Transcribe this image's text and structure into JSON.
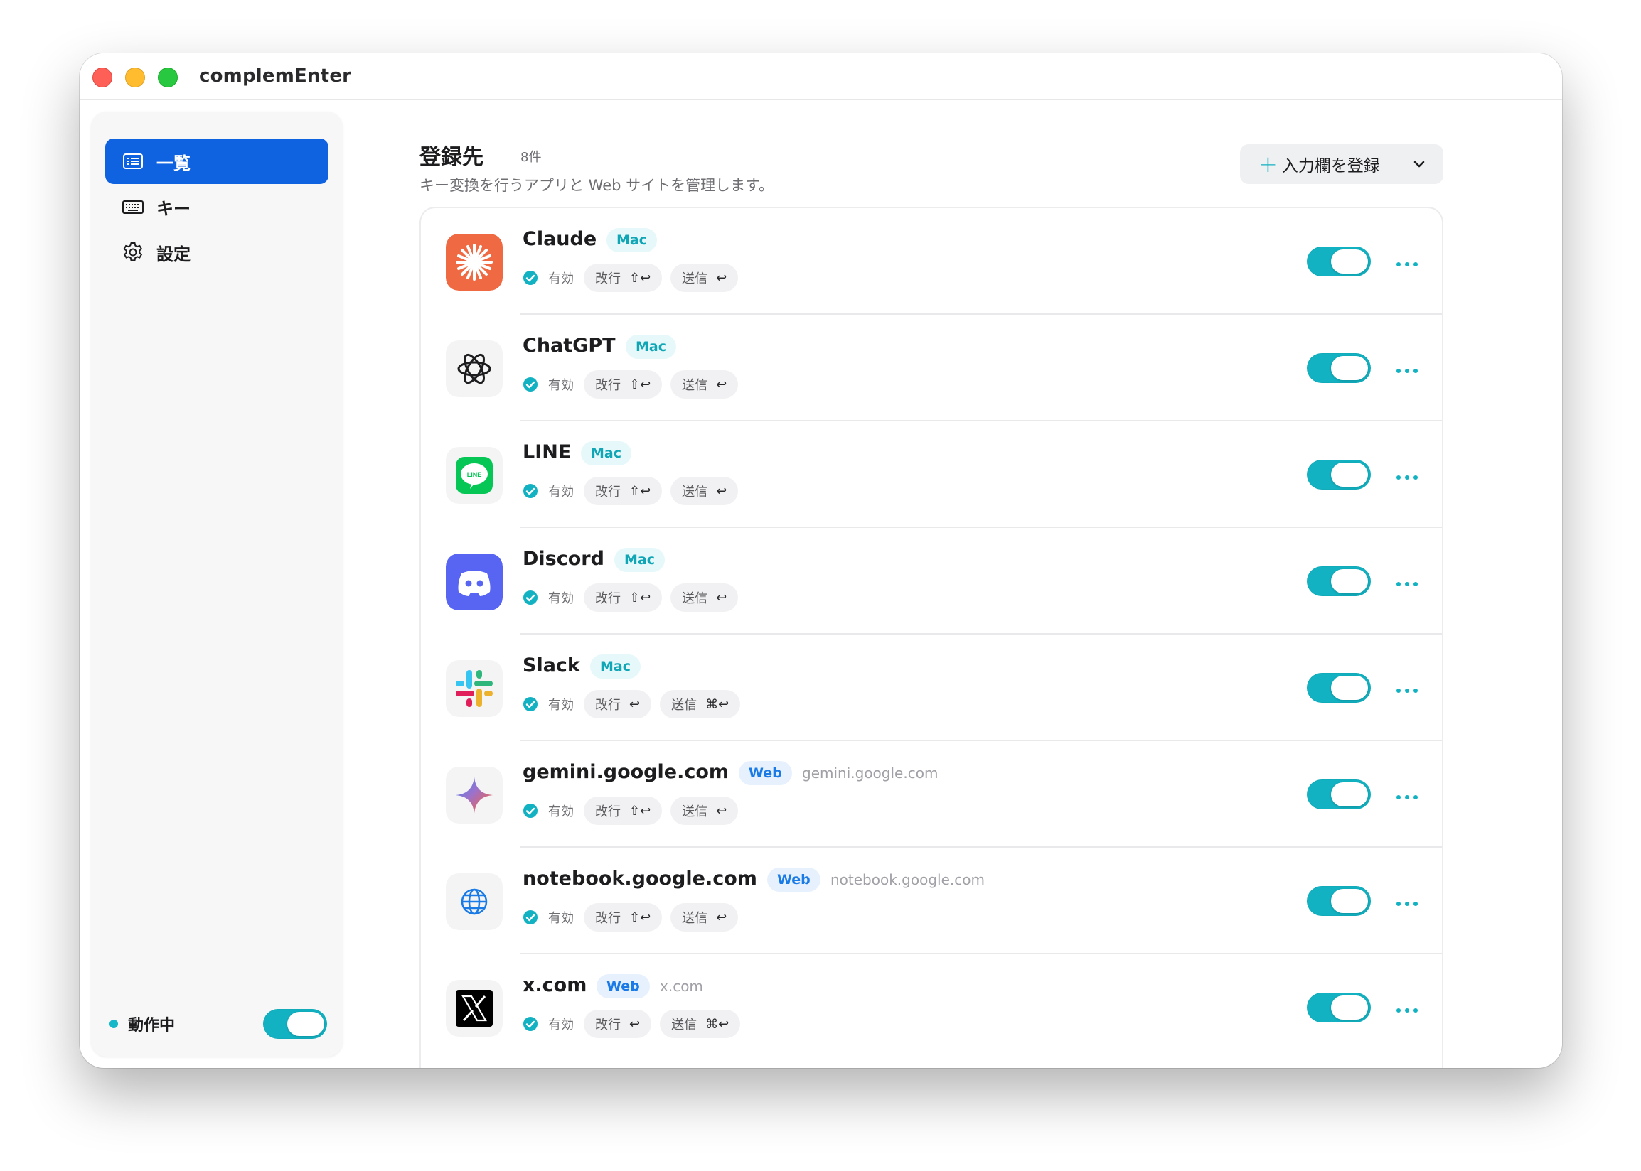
{
  "window": {
    "title": "complemEnter"
  },
  "sidebar": {
    "items": [
      {
        "label": "一覧",
        "icon": "list-icon",
        "active": true
      },
      {
        "label": "キー",
        "icon": "keyboard-icon",
        "active": false
      },
      {
        "label": "設定",
        "icon": "gear-icon",
        "active": false
      }
    ],
    "status_label": "動作中",
    "status_on": true
  },
  "header": {
    "title": "登録先",
    "count": "8件",
    "subtitle": "キー変換を行うアプリと Web サイトを管理します。",
    "register_label": "入力欄を登録"
  },
  "colors": {
    "accent": "#12b2c2",
    "active_nav": "#0f62e0",
    "mac_badge": "#11a6b6",
    "web_badge": "#1a7ae6"
  },
  "entries": [
    {
      "name": "Claude",
      "platform": "Mac",
      "domain": "",
      "icon": "claude-icon",
      "status": "有効",
      "newline_label": "改行",
      "newline_keys": "⇧↩",
      "send_label": "送信",
      "send_keys": "↩",
      "enabled": true
    },
    {
      "name": "ChatGPT",
      "platform": "Mac",
      "domain": "",
      "icon": "chatgpt-icon",
      "status": "有効",
      "newline_label": "改行",
      "newline_keys": "⇧↩",
      "send_label": "送信",
      "send_keys": "↩",
      "enabled": true
    },
    {
      "name": "LINE",
      "platform": "Mac",
      "domain": "",
      "icon": "line-icon",
      "status": "有効",
      "newline_label": "改行",
      "newline_keys": "⇧↩",
      "send_label": "送信",
      "send_keys": "↩",
      "enabled": true
    },
    {
      "name": "Discord",
      "platform": "Mac",
      "domain": "",
      "icon": "discord-icon",
      "status": "有効",
      "newline_label": "改行",
      "newline_keys": "⇧↩",
      "send_label": "送信",
      "send_keys": "↩",
      "enabled": true
    },
    {
      "name": "Slack",
      "platform": "Mac",
      "domain": "",
      "icon": "slack-icon",
      "status": "有効",
      "newline_label": "改行",
      "newline_keys": "↩",
      "send_label": "送信",
      "send_keys": "⌘↩",
      "enabled": true
    },
    {
      "name": "gemini.google.com",
      "platform": "Web",
      "domain": "gemini.google.com",
      "icon": "gemini-icon",
      "status": "有効",
      "newline_label": "改行",
      "newline_keys": "⇧↩",
      "send_label": "送信",
      "send_keys": "↩",
      "enabled": true
    },
    {
      "name": "notebook.google.com",
      "platform": "Web",
      "domain": "notebook.google.com",
      "icon": "globe-icon",
      "status": "有効",
      "newline_label": "改行",
      "newline_keys": "⇧↩",
      "send_label": "送信",
      "send_keys": "↩",
      "enabled": true
    },
    {
      "name": "x.com",
      "platform": "Web",
      "domain": "x.com",
      "icon": "x-icon",
      "status": "有効",
      "newline_label": "改行",
      "newline_keys": "↩",
      "send_label": "送信",
      "send_keys": "⌘↩",
      "enabled": true
    }
  ]
}
